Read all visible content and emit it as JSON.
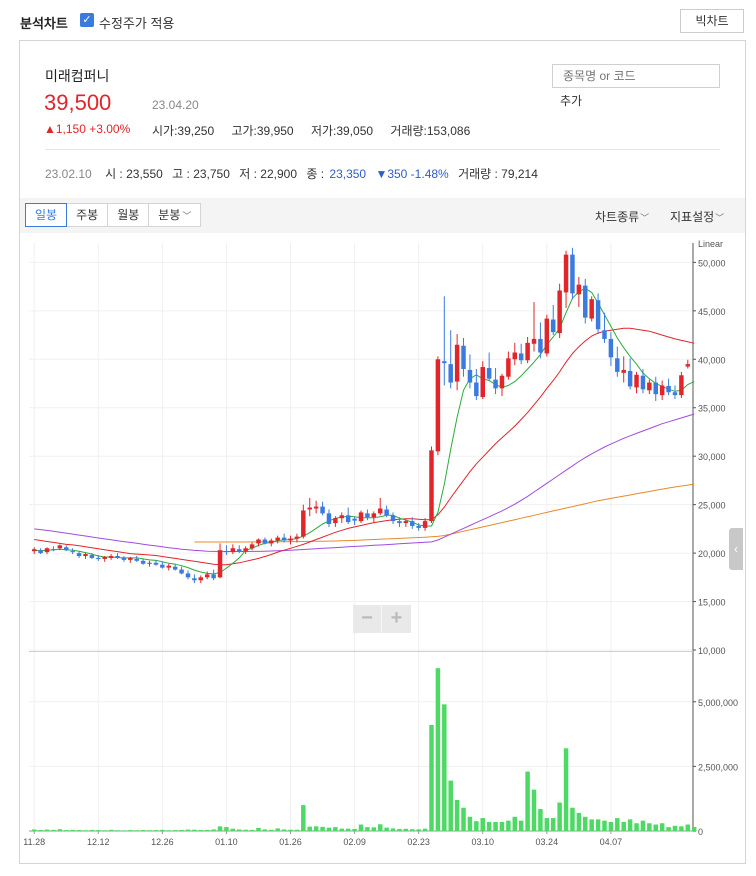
{
  "header": {
    "title": "분석차트",
    "adjusted_checkbox_label": "수정주가 적용",
    "adjusted_checked": true,
    "big_chart_label": "빅차트"
  },
  "stock": {
    "name": "미래컴퍼니",
    "price": "39,500",
    "date": "23.04.20",
    "change": "▲1,150 +3.00%",
    "open": "시가:39,250",
    "high": "고가:39,950",
    "low": "저가:39,050",
    "volume": "거래량:153,086"
  },
  "search": {
    "placeholder": "종목명 or 코드",
    "add_label": "추가"
  },
  "prev": {
    "date": "23.02.10",
    "open": "시 : 23,550",
    "high": "고 : 23,750",
    "low": "저 : 22,900",
    "close_label": "종 :",
    "close_value": "23,350",
    "change": "▼350 -1.48%",
    "volume": "거래량 : 79,214"
  },
  "toolbar": {
    "tabs": [
      "일봉",
      "주봉",
      "월봉",
      "분봉"
    ],
    "active_tab": 0,
    "chart_type_label": "차트종류",
    "indicator_label": "지표설정"
  },
  "zoom": {
    "minus": "−",
    "plus": "+"
  },
  "colors": {
    "up": "#e2252b",
    "down": "#3a7be0",
    "ma5": "#2bab3c",
    "ma20": "#e2252b",
    "ma60": "#a24be0",
    "ma120": "#e88a2a",
    "volume": "#4cd964"
  },
  "chart_data": {
    "type": "candlestick",
    "scale_label": "Linear",
    "price_ylim": [
      10000,
      52000
    ],
    "price_ticks": [
      "50,000",
      "45,000",
      "40,000",
      "35,000",
      "30,000",
      "25,000",
      "20,000",
      "15,000",
      "10,000"
    ],
    "volume_ylim": [
      0,
      6500000
    ],
    "volume_ticks": [
      "5,000,000",
      "2,500,000",
      "0"
    ],
    "x_ticks": [
      {
        "label": "11.28",
        "index": 0
      },
      {
        "label": "12.12",
        "index": 10
      },
      {
        "label": "12.26",
        "index": 20
      },
      {
        "label": "01.10",
        "index": 30
      },
      {
        "label": "01.26",
        "index": 40
      },
      {
        "label": "02.09",
        "index": 50
      },
      {
        "label": "02.23",
        "index": 60
      },
      {
        "label": "03.10",
        "index": 70
      },
      {
        "label": "03.24",
        "index": 80
      },
      {
        "label": "04.07",
        "index": 90
      }
    ],
    "ohlc": [
      [
        20200,
        20600,
        19900,
        20400
      ],
      [
        20300,
        20500,
        19900,
        20000
      ],
      [
        20100,
        20600,
        19900,
        20500
      ],
      [
        20400,
        20700,
        20200,
        20300
      ],
      [
        20500,
        20900,
        20300,
        20800
      ],
      [
        20600,
        20800,
        20200,
        20300
      ],
      [
        20200,
        20500,
        19900,
        20100
      ],
      [
        20000,
        20200,
        19500,
        19700
      ],
      [
        19700,
        20000,
        19400,
        19900
      ],
      [
        19800,
        20000,
        19400,
        19500
      ],
      [
        19500,
        19800,
        19200,
        19400
      ],
      [
        19400,
        19700,
        19100,
        19600
      ],
      [
        19500,
        19900,
        19300,
        19700
      ],
      [
        19700,
        20000,
        19400,
        19500
      ],
      [
        19500,
        19700,
        19100,
        19300
      ],
      [
        19300,
        19600,
        19000,
        19500
      ],
      [
        19400,
        19700,
        19100,
        19200
      ],
      [
        19200,
        19400,
        18800,
        18900
      ],
      [
        18900,
        19200,
        18600,
        19000
      ],
      [
        19000,
        19300,
        18700,
        18800
      ],
      [
        18800,
        19100,
        18400,
        18500
      ],
      [
        18500,
        18900,
        18200,
        18700
      ],
      [
        18600,
        18900,
        18200,
        18300
      ],
      [
        18300,
        18600,
        17800,
        17900
      ],
      [
        17900,
        18200,
        17300,
        17500
      ],
      [
        17400,
        17800,
        16900,
        17200
      ],
      [
        17200,
        17700,
        16900,
        17500
      ],
      [
        17500,
        18100,
        17300,
        17800
      ],
      [
        17800,
        18300,
        17200,
        17400
      ],
      [
        17500,
        21000,
        17400,
        20300
      ],
      [
        20200,
        20800,
        19800,
        20100
      ],
      [
        20100,
        20900,
        19900,
        20500
      ],
      [
        20400,
        20800,
        20000,
        20200
      ],
      [
        20200,
        20700,
        19900,
        20500
      ],
      [
        20500,
        21100,
        20300,
        20900
      ],
      [
        21000,
        21500,
        20700,
        21400
      ],
      [
        21400,
        21600,
        20900,
        21000
      ],
      [
        21000,
        21500,
        20700,
        21300
      ],
      [
        21300,
        21800,
        21000,
        21600
      ],
      [
        21600,
        22000,
        21100,
        21300
      ],
      [
        21300,
        21800,
        20900,
        21500
      ],
      [
        21500,
        22000,
        21100,
        21700
      ],
      [
        21700,
        25000,
        21500,
        24400
      ],
      [
        24500,
        25700,
        23800,
        24700
      ],
      [
        24600,
        25400,
        24100,
        24800
      ],
      [
        24800,
        25300,
        23900,
        24100
      ],
      [
        24100,
        24500,
        22700,
        23000
      ],
      [
        23100,
        23800,
        22700,
        23600
      ],
      [
        23600,
        24200,
        23100,
        23900
      ],
      [
        23900,
        24700,
        23000,
        23200
      ],
      [
        23550,
        23750,
        22900,
        23350
      ],
      [
        23300,
        24400,
        23100,
        24200
      ],
      [
        24100,
        24500,
        23400,
        23700
      ],
      [
        23700,
        24300,
        23200,
        24100
      ],
      [
        24100,
        25700,
        23900,
        24600
      ],
      [
        24500,
        24900,
        23700,
        23900
      ],
      [
        23900,
        24200,
        23000,
        23300
      ],
      [
        23300,
        23700,
        22700,
        23100
      ],
      [
        23100,
        23500,
        22700,
        23300
      ],
      [
        23300,
        23700,
        22500,
        22800
      ],
      [
        22800,
        23100,
        22300,
        22600
      ],
      [
        22600,
        23600,
        22300,
        23300
      ],
      [
        23300,
        31000,
        23100,
        30600
      ],
      [
        30500,
        40300,
        30100,
        40000
      ],
      [
        39800,
        46500,
        37300,
        39600
      ],
      [
        39500,
        43000,
        37000,
        37600
      ],
      [
        37700,
        42600,
        36800,
        41500
      ],
      [
        41400,
        42200,
        38200,
        39000
      ],
      [
        38900,
        40500,
        37000,
        37600
      ],
      [
        37600,
        39000,
        35800,
        36200
      ],
      [
        36100,
        39800,
        35900,
        39200
      ],
      [
        39100,
        40700,
        37800,
        38000
      ],
      [
        37900,
        39100,
        36400,
        37000
      ],
      [
        37000,
        38500,
        36200,
        38300
      ],
      [
        38200,
        40800,
        37900,
        40100
      ],
      [
        40000,
        41700,
        39400,
        40700
      ],
      [
        40600,
        41600,
        39500,
        39900
      ],
      [
        39900,
        42300,
        39600,
        41700
      ],
      [
        41600,
        45900,
        40800,
        42100
      ],
      [
        42100,
        43800,
        40100,
        40700
      ],
      [
        40600,
        44600,
        40300,
        44200
      ],
      [
        44100,
        45600,
        42500,
        42800
      ],
      [
        42700,
        47800,
        42200,
        47100
      ],
      [
        46900,
        51200,
        45300,
        50800
      ],
      [
        50800,
        51500,
        46200,
        46800
      ],
      [
        46700,
        48500,
        45400,
        47700
      ],
      [
        47600,
        48300,
        43700,
        44300
      ],
      [
        44200,
        46500,
        43900,
        46200
      ],
      [
        46100,
        46800,
        42600,
        43100
      ],
      [
        43000,
        44800,
        41700,
        42100
      ],
      [
        42100,
        42800,
        39300,
        40200
      ],
      [
        40100,
        41300,
        38200,
        38700
      ],
      [
        38600,
        40300,
        37600,
        38900
      ],
      [
        38800,
        40100,
        36900,
        37200
      ],
      [
        37100,
        38700,
        36500,
        38400
      ],
      [
        38300,
        39000,
        36500,
        36900
      ],
      [
        36800,
        37900,
        36400,
        37600
      ],
      [
        37600,
        38200,
        35700,
        36400
      ],
      [
        36300,
        37800,
        35800,
        37300
      ],
      [
        37250,
        38000,
        36300,
        36600
      ],
      [
        36600,
        37300,
        35900,
        36300
      ],
      [
        36300,
        38700,
        36000,
        38350
      ],
      [
        39250,
        39950,
        39050,
        39500
      ]
    ],
    "ma5": [
      20300,
      20250,
      20300,
      20350,
      20400,
      20350,
      20300,
      20200,
      20050,
      19900,
      19700,
      19600,
      19600,
      19550,
      19500,
      19500,
      19500,
      19400,
      19300,
      19250,
      19100,
      18950,
      18850,
      18700,
      18500,
      18250,
      18050,
      17900,
      17850,
      18000,
      18450,
      18950,
      19500,
      20300,
      20500,
      20800,
      21000,
      21100,
      21300,
      21350,
      21400,
      21500,
      21750,
      22100,
      22550,
      23000,
      23300,
      23600,
      23700,
      23800,
      23750,
      23650,
      23650,
      23650,
      23750,
      23900,
      23900,
      23600,
      23400,
      23200,
      22900,
      22800,
      22800,
      24200,
      27100,
      30700,
      34000,
      36800,
      38000,
      38400,
      38000,
      37800,
      37400,
      37100,
      37300,
      37700,
      38300,
      39000,
      39700,
      40500,
      41500,
      42300,
      43200,
      44800,
      46300,
      47000,
      47300,
      46900,
      45800,
      44600,
      43400,
      42200,
      41200,
      40300,
      39500,
      38600,
      38000,
      37500,
      37200,
      36900,
      36700,
      36800,
      37400,
      37700
    ],
    "ma20": [
      21400,
      21300,
      21200,
      21100,
      21000,
      20900,
      20850,
      20750,
      20650,
      20550,
      20450,
      20350,
      20250,
      20150,
      20050,
      19950,
      19900,
      19850,
      19800,
      19750,
      19650,
      19550,
      19450,
      19350,
      19250,
      19150,
      19050,
      18950,
      18850,
      18800,
      18800,
      18900,
      19000,
      19150,
      19300,
      19450,
      19650,
      19850,
      20100,
      20300,
      20500,
      20700,
      20900,
      21150,
      21400,
      21650,
      21900,
      22150,
      22350,
      22550,
      22700,
      22850,
      23000,
      23150,
      23250,
      23350,
      23450,
      23500,
      23550,
      23550,
      23500,
      23450,
      23450,
      23950,
      24750,
      25700,
      26600,
      27500,
      28400,
      29200,
      29900,
      30600,
      31300,
      31900,
      32500,
      33100,
      33800,
      34500,
      35300,
      36100,
      37000,
      37800,
      38700,
      39700,
      40600,
      41300,
      41900,
      42400,
      42700,
      42900,
      43000,
      43100,
      43200,
      43200,
      43100,
      43000,
      42900,
      42700,
      42500,
      42300,
      42100,
      41950,
      41800,
      41650
    ],
    "ma60": [
      22500,
      22420,
      22340,
      22250,
      22160,
      22060,
      21960,
      21860,
      21760,
      21660,
      21560,
      21460,
      21370,
      21280,
      21190,
      21100,
      21010,
      20920,
      20830,
      20740,
      20650,
      20560,
      20480,
      20400,
      20340,
      20280,
      20240,
      20200,
      20180,
      20170,
      20160,
      20160,
      20160,
      20160,
      20170,
      20180,
      20200,
      20220,
      20240,
      20270,
      20300,
      20330,
      20370,
      20410,
      20450,
      20490,
      20530,
      20570,
      20610,
      20650,
      20690,
      20720,
      20760,
      20800,
      20840,
      20880,
      20920,
      20960,
      21000,
      21040,
      21080,
      21120,
      21160,
      21350,
      21650,
      21950,
      22250,
      22550,
      22850,
      23150,
      23450,
      23750,
      24050,
      24350,
      24700,
      25050,
      25450,
      25850,
      26300,
      26750,
      27200,
      27650,
      28100,
      28550,
      29000,
      29450,
      29850,
      30250,
      30600,
      30950,
      31250,
      31550,
      31850,
      32100,
      32350,
      32600,
      32850,
      33100,
      33350,
      33550,
      33750,
      33950,
      34150,
      34350
    ],
    "ma120_start": 25,
    "ma120": [
      21150,
      21150,
      21150,
      21150,
      21150,
      21150,
      21150,
      21150,
      21150,
      21160,
      21160,
      21170,
      21170,
      21180,
      21180,
      21190,
      21190,
      21200,
      21210,
      21220,
      21230,
      21240,
      21250,
      21270,
      21290,
      21310,
      21340,
      21370,
      21400,
      21430,
      21460,
      21490,
      21520,
      21550,
      21580,
      21610,
      21640,
      21680,
      21720,
      21820,
      21950,
      22100,
      22250,
      22400,
      22550,
      22700,
      22850,
      23000,
      23150,
      23300,
      23450,
      23600,
      23750,
      23900,
      24050,
      24200,
      24350,
      24500,
      24650,
      24800,
      24950,
      25100,
      25250,
      25400,
      25520,
      25640,
      25760,
      25880,
      26000,
      26120,
      26240,
      26360,
      26480,
      26600,
      26720,
      26820,
      26920,
      27020,
      27120
    ],
    "volume": [
      60000,
      40000,
      55000,
      45000,
      70000,
      35000,
      45000,
      40000,
      30000,
      40000,
      35000,
      30000,
      45000,
      30000,
      25000,
      35000,
      30000,
      40000,
      30000,
      35000,
      45000,
      30000,
      35000,
      40000,
      55000,
      50000,
      40000,
      45000,
      60000,
      180000,
      150000,
      90000,
      60000,
      50000,
      45000,
      120000,
      60000,
      45000,
      100000,
      60000,
      50000,
      50000,
      1000000,
      170000,
      180000,
      160000,
      130000,
      150000,
      90000,
      90000,
      79214,
      250000,
      150000,
      140000,
      260000,
      130000,
      100000,
      80000,
      85000,
      70000,
      65000,
      90000,
      4100000,
      6300000,
      4900000,
      1950000,
      1200000,
      900000,
      550000,
      380000,
      500000,
      350000,
      350000,
      350000,
      400000,
      550000,
      400000,
      2300000,
      1600000,
      850000,
      500000,
      500000,
      1100000,
      3200000,
      900000,
      700000,
      550000,
      450000,
      450000,
      400000,
      350000,
      500000,
      350000,
      450000,
      300000,
      400000,
      300000,
      250000,
      300000,
      150000,
      200000,
      180000,
      250000,
      153086
    ]
  }
}
